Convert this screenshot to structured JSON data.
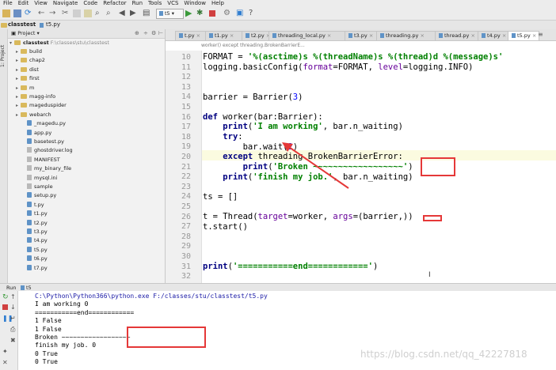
{
  "menubar": [
    "File",
    "Edit",
    "View",
    "Navigate",
    "Code",
    "Refactor",
    "Run",
    "Tools",
    "VCS",
    "Window",
    "Help"
  ],
  "toolbar": {
    "run_config": "t5"
  },
  "breadcrumb": [
    "classtest",
    "t5.py"
  ],
  "project": {
    "header": "Project",
    "root": "classtest",
    "root_path": "F:\\classes\\stu\\classtest",
    "items": [
      "build",
      "chap2",
      "dist",
      "first",
      "m",
      "magg-info",
      "mageduspider",
      "webarch",
      "_magedu.py",
      "app.py",
      "basetest.py",
      "ghostdriver.log",
      "MANIFEST",
      "my_binary_file",
      "mysql.ini",
      "sample",
      "setup.py",
      "t.py",
      "t1.py",
      "t2.py",
      "t3.py",
      "t4.py",
      "t5.py",
      "t6.py",
      "t7.py"
    ]
  },
  "tabs": [
    "t.py",
    "t1.py",
    "t2.py",
    "threading_local.py",
    "t3.py",
    "threading.py",
    "thread.py",
    "t4.py",
    "t5.py"
  ],
  "editor": {
    "breadcrumb": "worker()   except threading.BrokenBarrierE...",
    "line_numbers": [
      "10",
      "11",
      "12",
      "13",
      "14",
      "15",
      "16",
      "17",
      "18",
      "19",
      "20",
      "21",
      "22",
      "23",
      "24",
      "25",
      "26",
      "27",
      "28",
      "29",
      "30",
      "31",
      "32"
    ]
  },
  "run": {
    "tab_label": "Run",
    "config": "t5",
    "output": [
      "C:\\Python\\Python366\\python.exe F:/classes/stu/classtest/t5.py",
      "I am working 0",
      "===========end============",
      "1 False",
      "1 False",
      "Broken ~~~~~~~~~~~~~~~~~~",
      "finish my job. 0",
      "0 True",
      "0 True"
    ]
  },
  "watermark": "https://blog.csdn.net/qq_42227818",
  "colors": {
    "annotation": "#e53838",
    "keyword": "#000080",
    "string": "#008000",
    "number": "#0000ff"
  }
}
